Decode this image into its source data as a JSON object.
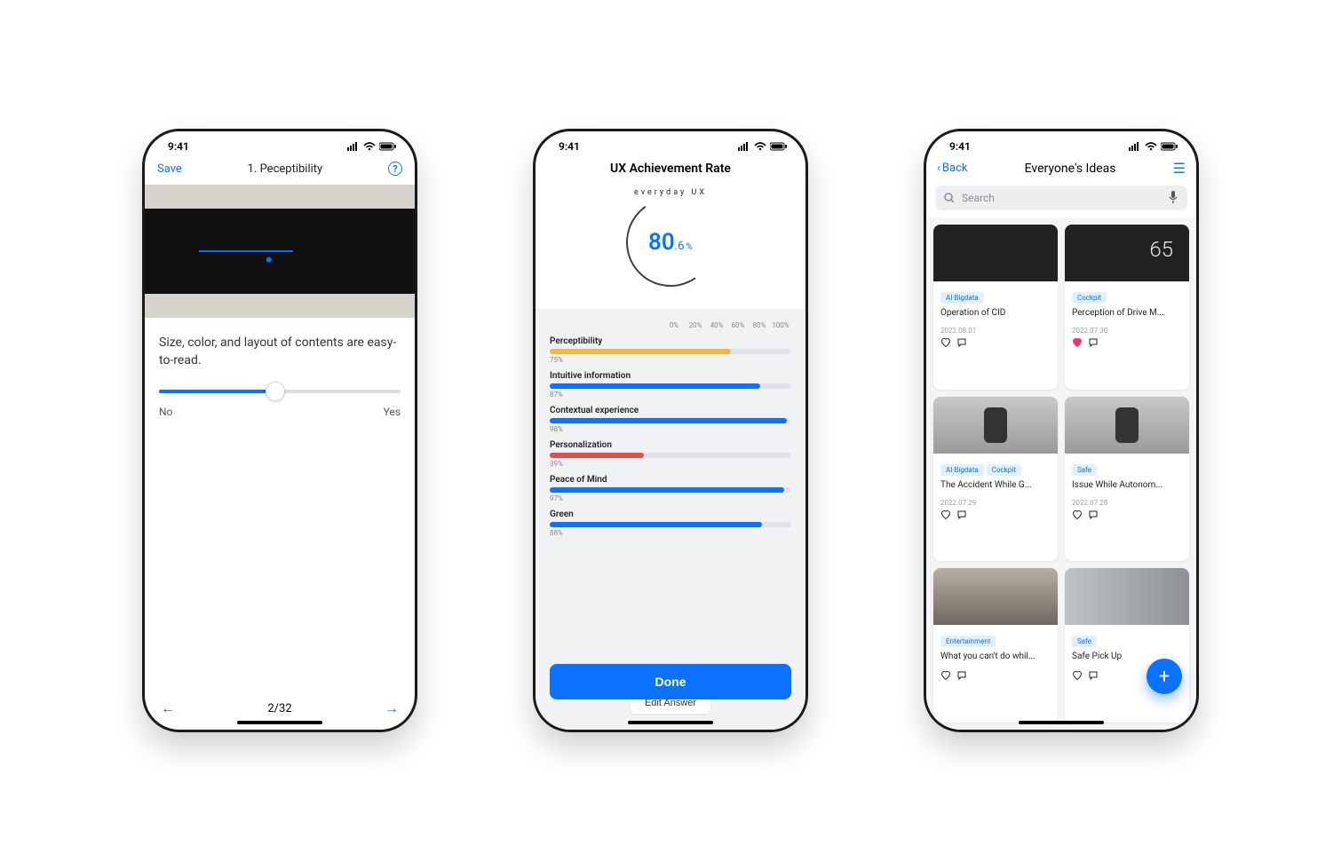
{
  "status": {
    "time": "9:41"
  },
  "phone1": {
    "save": "Save",
    "title": "1. Peceptibility",
    "question": "Size, color, and layout of contents are easy-to-read.",
    "label_no": "No",
    "label_yes": "Yes",
    "slider_pct": 48,
    "page": "2/32"
  },
  "phone2": {
    "title": "UX Achievement Rate",
    "arc_label": "everyday UX",
    "rate_int": "80",
    "rate_dec": ".6",
    "rate_unit": "%",
    "axis": [
      "0%",
      "20%",
      "40%",
      "60%",
      "80%",
      "100%"
    ],
    "edit": "Edit Answer",
    "done": "Done"
  },
  "chart_data": {
    "type": "bar",
    "categories": [
      "Perceptibility",
      "Intuitive information",
      "Contextual experience",
      "Personalization",
      "Peace of Mind",
      "Green"
    ],
    "values": [
      75,
      87,
      98,
      39,
      97,
      88
    ],
    "colors": [
      "#f6b73c",
      "#0a72ff",
      "#0a72ff",
      "#e74a4a",
      "#0a72ff",
      "#0a72ff"
    ],
    "xlabel": "",
    "ylabel": "",
    "ylim": [
      0,
      100
    ],
    "title": "UX Achievement Rate"
  },
  "phone3": {
    "back": "Back",
    "title": "Everyone's Ideas",
    "search_placeholder": "Search",
    "cards": [
      {
        "tags": [
          "AI·Bigdata"
        ],
        "title": "Operation of CID",
        "date": "2022.08.01",
        "liked": false
      },
      {
        "tags": [
          "Cockpit"
        ],
        "title": "Perception of Drive M...",
        "date": "2022.07.30",
        "liked": true,
        "speed": "65"
      },
      {
        "tags": [
          "AI·Bigdata",
          "Cockpit"
        ],
        "title": "The Accident While G...",
        "date": "2022.07.29",
        "liked": false
      },
      {
        "tags": [
          "Safe"
        ],
        "title": "Issue While Autonom...",
        "date": "2022.07.28",
        "liked": false
      },
      {
        "tags": [
          "Entertainment"
        ],
        "title": "What you can't do whil...",
        "date": "",
        "liked": false
      },
      {
        "tags": [
          "Safe"
        ],
        "title": "Safe Pick Up",
        "date": "",
        "liked": false
      }
    ]
  }
}
